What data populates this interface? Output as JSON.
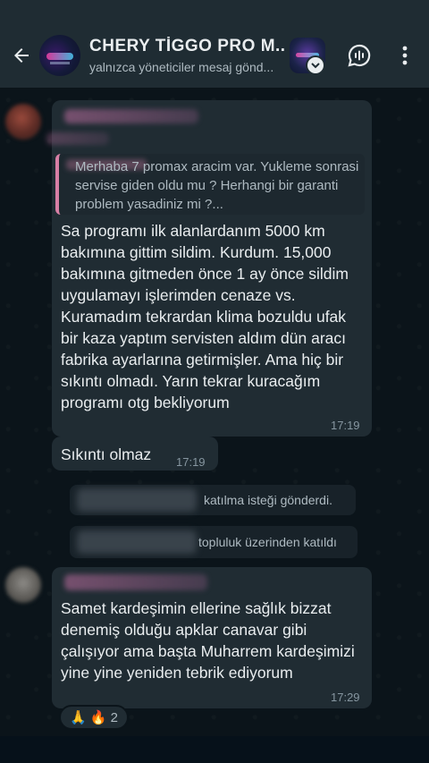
{
  "header": {
    "title": "CHERY TİGGO PRO M...",
    "subtitle": "yalnızca yöneticiler mesaj gönd...",
    "back_icon": "arrow-left-icon",
    "voice_icon": "voice-chat-icon",
    "menu_icon": "more-vertical-icon"
  },
  "messages": [
    {
      "type": "incoming",
      "quote": "Merhaba 7 promax aracim var. Yukleme sonrasi servise giden oldu mu ? Herhangi bir garanti problem yasadiniz mi ?...",
      "text": "Sa programı ilk alanlardanım 5000 km bakımına gittim sildim. Kurdum. 15,000 bakımına gitmeden önce 1 ay önce sildim uygulamayı işlerimden cenaze vs. Kuramadım tekrardan klima bozuldu ufak bir kaza yaptım servisten aldım dün aracı fabrika ayarlarına getirmişler. Ama hiç bir sıkıntı olmadı. Yarın tekrar kuracağım programı otg bekliyorum",
      "time": "17:19"
    },
    {
      "type": "incoming",
      "text": "Sıkıntı olmaz",
      "time": "17:19"
    },
    {
      "type": "incoming",
      "text": "Samet kardeşimin ellerine sağlık bizzat denemiş olduğu apklar canavar gibi çalışıyor ama başta Muharrem kardeşimizi yine yine yeniden tebrik ediyorum",
      "time": "17:29",
      "reactions": {
        "emojis": "🙏 🔥",
        "count": "2"
      }
    }
  ],
  "system_messages": [
    "katılma isteği gönderdi.",
    "topluluk üzerinden katıldı"
  ],
  "colors": {
    "background": "#0b141a",
    "header": "#1f2c33",
    "bubble": "#202c33",
    "quote_bar": "#d87fa6"
  }
}
